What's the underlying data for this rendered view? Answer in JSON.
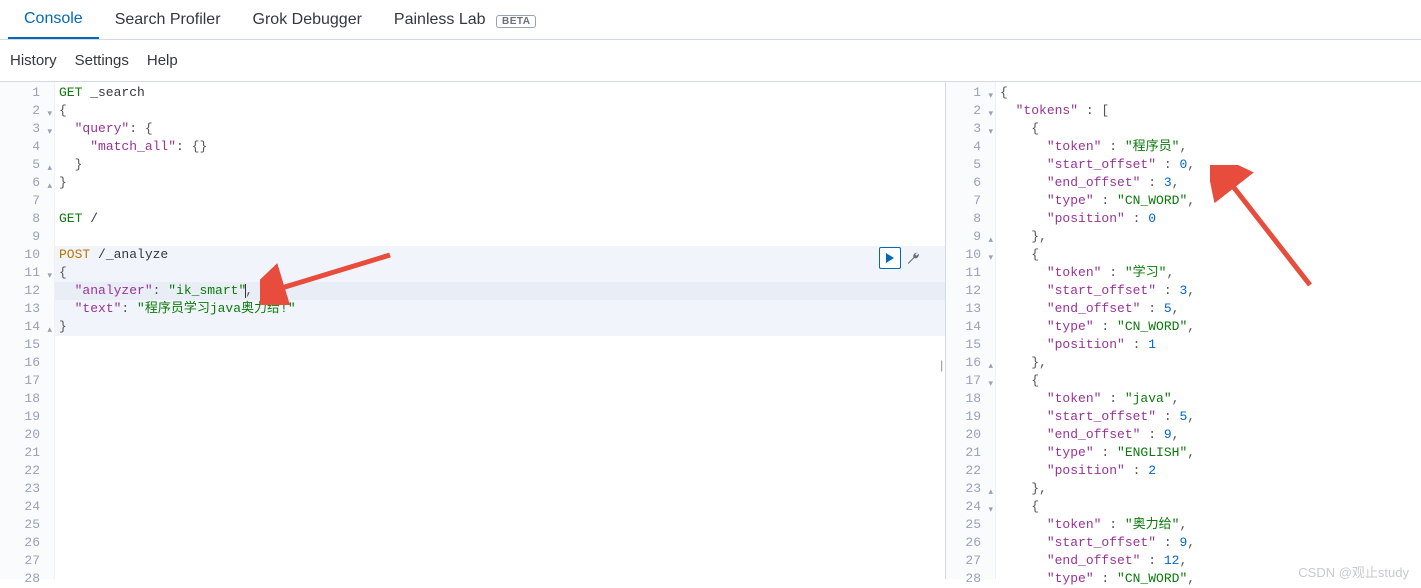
{
  "tabs": {
    "console": "Console",
    "search_profiler": "Search Profiler",
    "grok_debugger": "Grok Debugger",
    "painless_lab": "Painless Lab",
    "beta_badge": "BETA"
  },
  "subbar": {
    "history": "History",
    "settings": "Settings",
    "help": "Help"
  },
  "request_editor": {
    "lines": [
      {
        "n": "1",
        "fold": "",
        "text": [
          {
            "t": "GET",
            "c": "method"
          },
          {
            "t": " _search",
            "c": ""
          }
        ]
      },
      {
        "n": "2",
        "fold": "▾",
        "text": [
          {
            "t": "{",
            "c": "pun"
          }
        ]
      },
      {
        "n": "3",
        "fold": "▾",
        "text": [
          {
            "t": "  ",
            "c": ""
          },
          {
            "t": "\"query\"",
            "c": "key"
          },
          {
            "t": ": {",
            "c": "pun"
          }
        ]
      },
      {
        "n": "4",
        "fold": "",
        "text": [
          {
            "t": "    ",
            "c": ""
          },
          {
            "t": "\"match_all\"",
            "c": "key"
          },
          {
            "t": ": {}",
            "c": "pun"
          }
        ]
      },
      {
        "n": "5",
        "fold": "▴",
        "text": [
          {
            "t": "  }",
            "c": "pun"
          }
        ]
      },
      {
        "n": "6",
        "fold": "▴",
        "text": [
          {
            "t": "}",
            "c": "pun"
          }
        ]
      },
      {
        "n": "7",
        "fold": "",
        "text": []
      },
      {
        "n": "8",
        "fold": "",
        "text": [
          {
            "t": "GET",
            "c": "method"
          },
          {
            "t": " /",
            "c": ""
          }
        ]
      },
      {
        "n": "9",
        "fold": "",
        "text": []
      },
      {
        "n": "10",
        "fold": "",
        "text": [
          {
            "t": "POST",
            "c": "post"
          },
          {
            "t": " /_analyze",
            "c": ""
          }
        ],
        "hl": true
      },
      {
        "n": "11",
        "fold": "▾",
        "text": [
          {
            "t": "{",
            "c": "pun"
          }
        ],
        "hl": true
      },
      {
        "n": "12",
        "fold": "",
        "text": [
          {
            "t": "  ",
            "c": ""
          },
          {
            "t": "\"analyzer\"",
            "c": "key"
          },
          {
            "t": ": ",
            "c": "pun"
          },
          {
            "t": "\"ik_smart\"",
            "c": "str"
          },
          {
            "t": ",",
            "c": "pun"
          }
        ],
        "hl2": true,
        "cursor": true
      },
      {
        "n": "13",
        "fold": "",
        "text": [
          {
            "t": "  ",
            "c": ""
          },
          {
            "t": "\"text\"",
            "c": "key"
          },
          {
            "t": ": ",
            "c": "pun"
          },
          {
            "t": "\"程序员学习java奥力给!\"",
            "c": "str"
          }
        ],
        "hl": true
      },
      {
        "n": "14",
        "fold": "▴",
        "text": [
          {
            "t": "}",
            "c": "pun"
          }
        ],
        "hl": true
      },
      {
        "n": "15",
        "fold": "",
        "text": []
      },
      {
        "n": "16",
        "fold": "",
        "text": []
      },
      {
        "n": "17",
        "fold": "",
        "text": []
      },
      {
        "n": "18",
        "fold": "",
        "text": []
      },
      {
        "n": "19",
        "fold": "",
        "text": []
      },
      {
        "n": "20",
        "fold": "",
        "text": []
      },
      {
        "n": "21",
        "fold": "",
        "text": []
      },
      {
        "n": "22",
        "fold": "",
        "text": []
      },
      {
        "n": "23",
        "fold": "",
        "text": []
      },
      {
        "n": "24",
        "fold": "",
        "text": []
      },
      {
        "n": "25",
        "fold": "",
        "text": []
      },
      {
        "n": "26",
        "fold": "",
        "text": []
      },
      {
        "n": "27",
        "fold": "",
        "text": []
      },
      {
        "n": "28",
        "fold": "",
        "text": []
      }
    ]
  },
  "response_editor": {
    "lines": [
      {
        "n": "1",
        "fold": "▾",
        "text": [
          {
            "t": "{",
            "c": "pun"
          }
        ]
      },
      {
        "n": "2",
        "fold": "▾",
        "text": [
          {
            "t": "  ",
            "c": ""
          },
          {
            "t": "\"tokens\"",
            "c": "key"
          },
          {
            "t": " : [",
            "c": "pun"
          }
        ]
      },
      {
        "n": "3",
        "fold": "▾",
        "text": [
          {
            "t": "    {",
            "c": "pun"
          }
        ]
      },
      {
        "n": "4",
        "fold": "",
        "text": [
          {
            "t": "      ",
            "c": ""
          },
          {
            "t": "\"token\"",
            "c": "key"
          },
          {
            "t": " : ",
            "c": "pun"
          },
          {
            "t": "\"程序员\"",
            "c": "str"
          },
          {
            "t": ",",
            "c": "pun"
          }
        ]
      },
      {
        "n": "5",
        "fold": "",
        "text": [
          {
            "t": "      ",
            "c": ""
          },
          {
            "t": "\"start_offset\"",
            "c": "key"
          },
          {
            "t": " : ",
            "c": "pun"
          },
          {
            "t": "0",
            "c": "num"
          },
          {
            "t": ",",
            "c": "pun"
          }
        ]
      },
      {
        "n": "6",
        "fold": "",
        "text": [
          {
            "t": "      ",
            "c": ""
          },
          {
            "t": "\"end_offset\"",
            "c": "key"
          },
          {
            "t": " : ",
            "c": "pun"
          },
          {
            "t": "3",
            "c": "num"
          },
          {
            "t": ",",
            "c": "pun"
          }
        ]
      },
      {
        "n": "7",
        "fold": "",
        "text": [
          {
            "t": "      ",
            "c": ""
          },
          {
            "t": "\"type\"",
            "c": "key"
          },
          {
            "t": " : ",
            "c": "pun"
          },
          {
            "t": "\"CN_WORD\"",
            "c": "str"
          },
          {
            "t": ",",
            "c": "pun"
          }
        ]
      },
      {
        "n": "8",
        "fold": "",
        "text": [
          {
            "t": "      ",
            "c": ""
          },
          {
            "t": "\"position\"",
            "c": "key"
          },
          {
            "t": " : ",
            "c": "pun"
          },
          {
            "t": "0",
            "c": "num"
          }
        ]
      },
      {
        "n": "9",
        "fold": "▴",
        "text": [
          {
            "t": "    },",
            "c": "pun"
          }
        ]
      },
      {
        "n": "10",
        "fold": "▾",
        "text": [
          {
            "t": "    {",
            "c": "pun"
          }
        ]
      },
      {
        "n": "11",
        "fold": "",
        "text": [
          {
            "t": "      ",
            "c": ""
          },
          {
            "t": "\"token\"",
            "c": "key"
          },
          {
            "t": " : ",
            "c": "pun"
          },
          {
            "t": "\"学习\"",
            "c": "str"
          },
          {
            "t": ",",
            "c": "pun"
          }
        ]
      },
      {
        "n": "12",
        "fold": "",
        "text": [
          {
            "t": "      ",
            "c": ""
          },
          {
            "t": "\"start_offset\"",
            "c": "key"
          },
          {
            "t": " : ",
            "c": "pun"
          },
          {
            "t": "3",
            "c": "num"
          },
          {
            "t": ",",
            "c": "pun"
          }
        ]
      },
      {
        "n": "13",
        "fold": "",
        "text": [
          {
            "t": "      ",
            "c": ""
          },
          {
            "t": "\"end_offset\"",
            "c": "key"
          },
          {
            "t": " : ",
            "c": "pun"
          },
          {
            "t": "5",
            "c": "num"
          },
          {
            "t": ",",
            "c": "pun"
          }
        ]
      },
      {
        "n": "14",
        "fold": "",
        "text": [
          {
            "t": "      ",
            "c": ""
          },
          {
            "t": "\"type\"",
            "c": "key"
          },
          {
            "t": " : ",
            "c": "pun"
          },
          {
            "t": "\"CN_WORD\"",
            "c": "str"
          },
          {
            "t": ",",
            "c": "pun"
          }
        ]
      },
      {
        "n": "15",
        "fold": "",
        "text": [
          {
            "t": "      ",
            "c": ""
          },
          {
            "t": "\"position\"",
            "c": "key"
          },
          {
            "t": " : ",
            "c": "pun"
          },
          {
            "t": "1",
            "c": "num"
          }
        ]
      },
      {
        "n": "16",
        "fold": "▴",
        "text": [
          {
            "t": "    },",
            "c": "pun"
          }
        ]
      },
      {
        "n": "17",
        "fold": "▾",
        "text": [
          {
            "t": "    {",
            "c": "pun"
          }
        ]
      },
      {
        "n": "18",
        "fold": "",
        "text": [
          {
            "t": "      ",
            "c": ""
          },
          {
            "t": "\"token\"",
            "c": "key"
          },
          {
            "t": " : ",
            "c": "pun"
          },
          {
            "t": "\"java\"",
            "c": "str"
          },
          {
            "t": ",",
            "c": "pun"
          }
        ]
      },
      {
        "n": "19",
        "fold": "",
        "text": [
          {
            "t": "      ",
            "c": ""
          },
          {
            "t": "\"start_offset\"",
            "c": "key"
          },
          {
            "t": " : ",
            "c": "pun"
          },
          {
            "t": "5",
            "c": "num"
          },
          {
            "t": ",",
            "c": "pun"
          }
        ]
      },
      {
        "n": "20",
        "fold": "",
        "text": [
          {
            "t": "      ",
            "c": ""
          },
          {
            "t": "\"end_offset\"",
            "c": "key"
          },
          {
            "t": " : ",
            "c": "pun"
          },
          {
            "t": "9",
            "c": "num"
          },
          {
            "t": ",",
            "c": "pun"
          }
        ]
      },
      {
        "n": "21",
        "fold": "",
        "text": [
          {
            "t": "      ",
            "c": ""
          },
          {
            "t": "\"type\"",
            "c": "key"
          },
          {
            "t": " : ",
            "c": "pun"
          },
          {
            "t": "\"ENGLISH\"",
            "c": "str"
          },
          {
            "t": ",",
            "c": "pun"
          }
        ]
      },
      {
        "n": "22",
        "fold": "",
        "text": [
          {
            "t": "      ",
            "c": ""
          },
          {
            "t": "\"position\"",
            "c": "key"
          },
          {
            "t": " : ",
            "c": "pun"
          },
          {
            "t": "2",
            "c": "num"
          }
        ]
      },
      {
        "n": "23",
        "fold": "▴",
        "text": [
          {
            "t": "    },",
            "c": "pun"
          }
        ]
      },
      {
        "n": "24",
        "fold": "▾",
        "text": [
          {
            "t": "    {",
            "c": "pun"
          }
        ]
      },
      {
        "n": "25",
        "fold": "",
        "text": [
          {
            "t": "      ",
            "c": ""
          },
          {
            "t": "\"token\"",
            "c": "key"
          },
          {
            "t": " : ",
            "c": "pun"
          },
          {
            "t": "\"奥力给\"",
            "c": "str"
          },
          {
            "t": ",",
            "c": "pun"
          }
        ]
      },
      {
        "n": "26",
        "fold": "",
        "text": [
          {
            "t": "      ",
            "c": ""
          },
          {
            "t": "\"start_offset\"",
            "c": "key"
          },
          {
            "t": " : ",
            "c": "pun"
          },
          {
            "t": "9",
            "c": "num"
          },
          {
            "t": ",",
            "c": "pun"
          }
        ]
      },
      {
        "n": "27",
        "fold": "",
        "text": [
          {
            "t": "      ",
            "c": ""
          },
          {
            "t": "\"end_offset\"",
            "c": "key"
          },
          {
            "t": " : ",
            "c": "pun"
          },
          {
            "t": "12",
            "c": "num"
          },
          {
            "t": ",",
            "c": "pun"
          }
        ]
      },
      {
        "n": "28",
        "fold": "",
        "text": [
          {
            "t": "      ",
            "c": ""
          },
          {
            "t": "\"type\"",
            "c": "key"
          },
          {
            "t": " : ",
            "c": "pun"
          },
          {
            "t": "\"CN_WORD\"",
            "c": "str"
          },
          {
            "t": ",",
            "c": "pun"
          }
        ]
      }
    ]
  },
  "watermark": "CSDN @观止study"
}
